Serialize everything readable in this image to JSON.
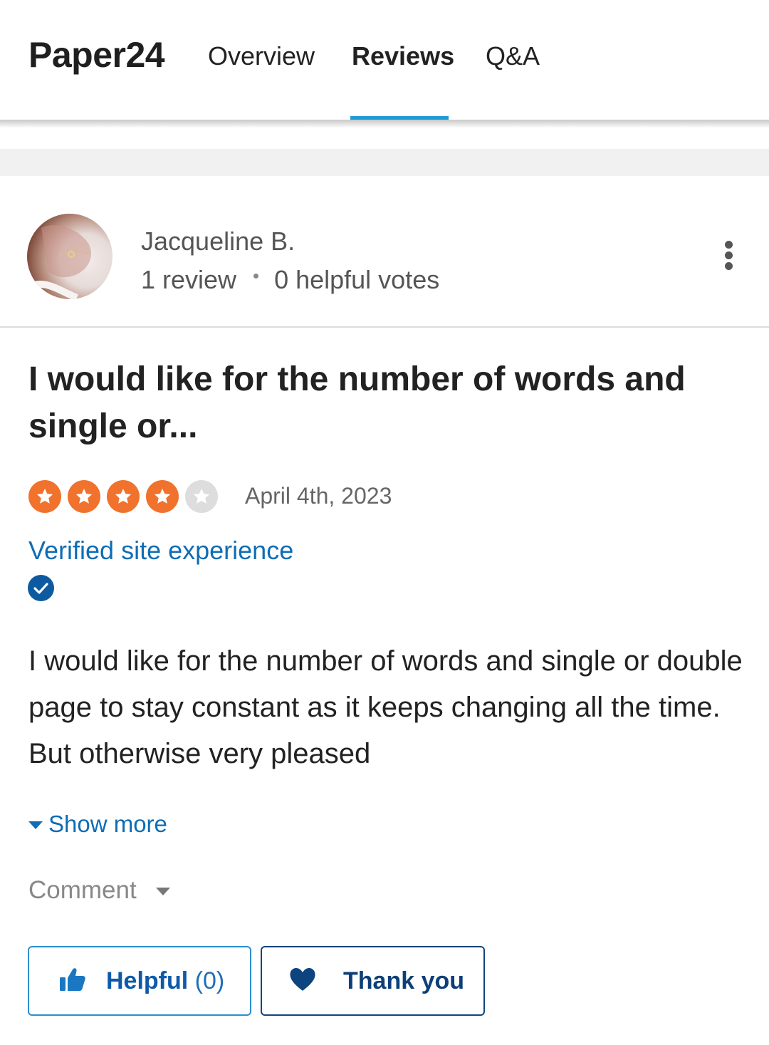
{
  "header": {
    "brand": "Paper24",
    "tabs": [
      {
        "label": "Overview"
      },
      {
        "label": "Reviews",
        "active": true
      },
      {
        "label": "Q&A"
      }
    ],
    "accent_color": "#1e9bd6"
  },
  "reviewer": {
    "name": "Jacqueline B.",
    "review_count": "1 review",
    "helpful_votes": "0 helpful votes"
  },
  "review": {
    "title": "I would like for the number of words and single or...",
    "rating": 4,
    "rating_max": 5,
    "star_color": "#f0722c",
    "date": "April 4th, 2023",
    "verified_label": "Verified site experience",
    "body": "I would like for the number of words and single or double page to stay constant as it keeps changing all the time. But otherwise very pleased",
    "show_more": "Show more",
    "comment": "Comment"
  },
  "actions": {
    "helpful_label": "Helpful",
    "helpful_count": "(0)",
    "thanks_label": "Thank you"
  },
  "icons": {
    "more": "kebab-menu-icon",
    "verified": "check-circle-icon",
    "helpful": "thumbs-up-icon",
    "thanks": "heart-icon"
  }
}
